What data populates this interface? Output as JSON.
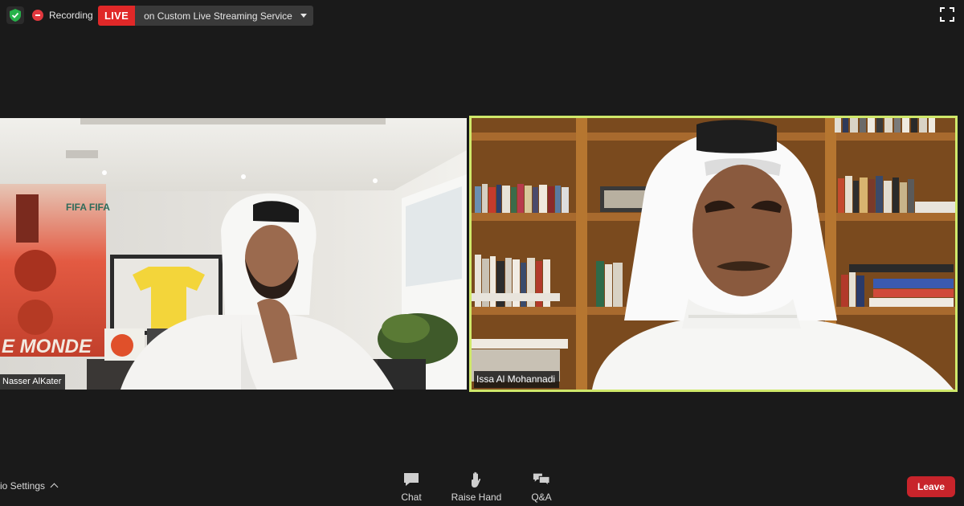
{
  "topbar": {
    "recording_label": "Recording",
    "live_badge": "LIVE",
    "live_service": "on Custom Live Streaming Service"
  },
  "participants": [
    {
      "name": "Nasser AlKater",
      "active_speaker": false
    },
    {
      "name": "Issa Al Mohannadi",
      "active_speaker": true
    }
  ],
  "left_scene_text": {
    "poster_word": "E MONDE",
    "poster_top": "FIFA FIFA"
  },
  "toolbar": {
    "audio_settings": "io Settings",
    "chat": "Chat",
    "raise_hand": "Raise Hand",
    "qa": "Q&A",
    "leave": "Leave"
  },
  "colors": {
    "background": "#1a1a1a",
    "live_red": "#e02828",
    "speaker_border": "#cfe86a",
    "leave_red": "#c8242b",
    "shield_green": "#27b24a"
  },
  "icons": [
    "shield-icon",
    "recording-icon",
    "caret-down-icon",
    "fullscreen-icon",
    "chevron-up-icon",
    "chat-icon",
    "raise-hand-icon",
    "qa-icon"
  ]
}
